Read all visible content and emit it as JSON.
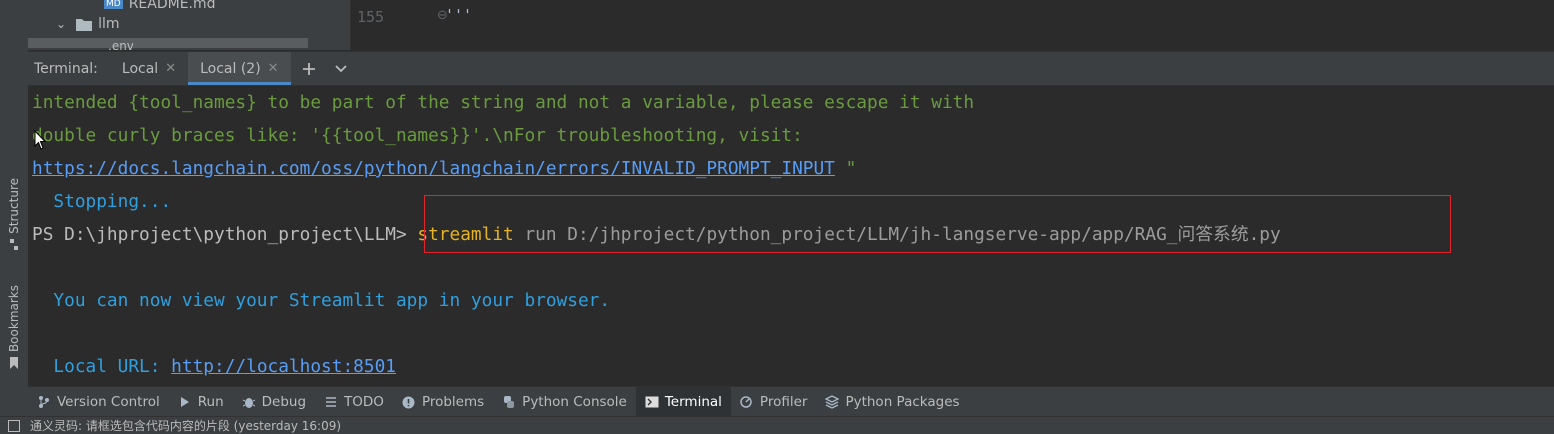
{
  "sidebar": {
    "structure_label": "Structure",
    "bookmarks_label": "Bookmarks"
  },
  "project_tree": {
    "readme": "README.md",
    "llm_folder": "llm",
    "env_file": ".env"
  },
  "editor": {
    "line_number": "155",
    "code": "'''"
  },
  "terminal_bar": {
    "label": "Terminal:",
    "tabs": [
      {
        "label": "Local",
        "active": false
      },
      {
        "label": "Local (2)",
        "active": true
      }
    ]
  },
  "terminal": {
    "err_line1": "intended {tool_names} to be part of the string and not a variable, please escape it with",
    "err_line2": "double curly braces like: '{{tool_names}}'.\\nFor troubleshooting, visit:",
    "err_link": "https://docs.langchain.com/oss/python/langchain/errors/INVALID_PROMPT_INPUT",
    "err_quote": " \"",
    "stopping": "  Stopping...",
    "prompt": "PS D:\\jhproject\\python_project\\LLM> ",
    "command": "streamlit",
    "args": " run D:/jhproject/python_project/LLM/jh-langserve-app/app/RAG_问答系统.py",
    "view_msg": "  You can now view your Streamlit app in your browser.",
    "local_url_label": "  Local URL: ",
    "local_url": "http://localhost:8501"
  },
  "tool_windows": [
    {
      "label": "Version Control",
      "icon": "branch-icon",
      "active": false
    },
    {
      "label": "Run",
      "icon": "play-icon",
      "active": false
    },
    {
      "label": "Debug",
      "icon": "bug-icon",
      "active": false
    },
    {
      "label": "TODO",
      "icon": "list-icon",
      "active": false
    },
    {
      "label": "Problems",
      "icon": "alert-icon",
      "active": false
    },
    {
      "label": "Python Console",
      "icon": "python-icon",
      "active": false
    },
    {
      "label": "Terminal",
      "icon": "terminal-icon",
      "active": true
    },
    {
      "label": "Profiler",
      "icon": "profiler-icon",
      "active": false
    },
    {
      "label": "Python Packages",
      "icon": "packages-icon",
      "active": false
    }
  ],
  "status_bar": {
    "message": "通义灵码: 请框选包含代码内容的片段 (yesterday 16:09)"
  },
  "colors": {
    "accent": "#4a88c7",
    "highlight_box": "#e0262b",
    "command": "#e6b422",
    "error_text": "#6a9b3f",
    "info_text": "#2ea0e0"
  }
}
